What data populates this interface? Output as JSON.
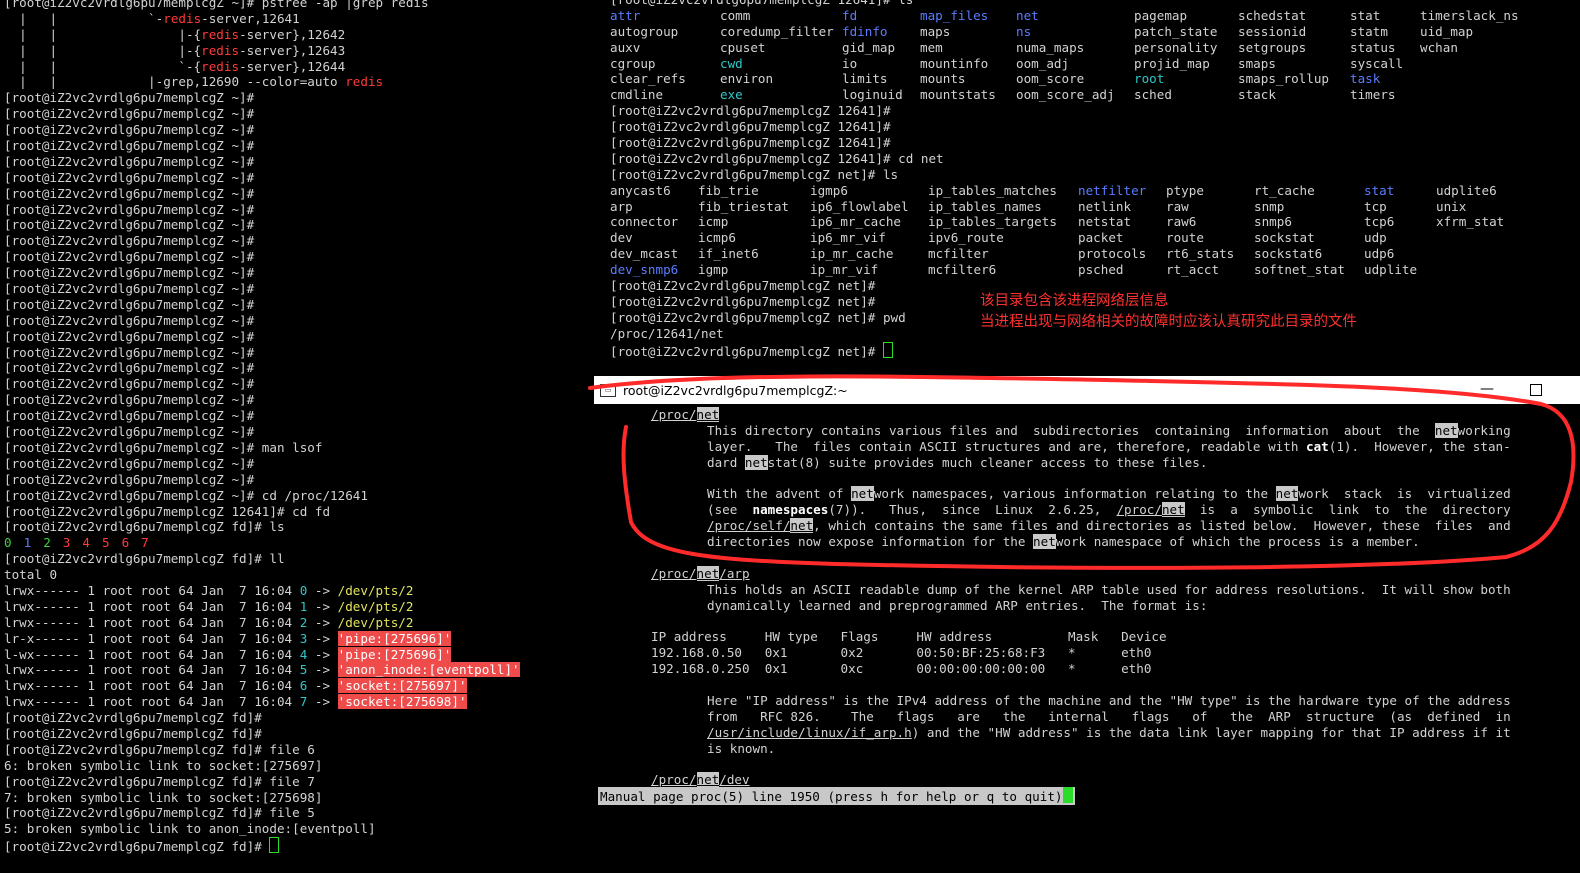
{
  "left_terminal": {
    "pstree_lines": [
      {
        "pre": "[root@iZ2vc2vrdlg6pu7memplcgZ ~]# pstree -ap |grep redis"
      },
      {
        "pre": "  |   |            `-",
        "red": "redis",
        "post": "-server,12641"
      },
      {
        "pre": "  |   |                |-{",
        "red": "redis",
        "post": "-server},12642"
      },
      {
        "pre": "  |   |                |-{",
        "red": "redis",
        "post": "-server},12643"
      },
      {
        "pre": "  |   |                `-{",
        "red": "redis",
        "post": "-server},12644"
      },
      {
        "pre": "  |   |            |-grep,12690 --color=auto ",
        "red": "redis",
        "post": ""
      }
    ],
    "prompt_home": "[root@iZ2vc2vrdlg6pu7memplcgZ ~]#",
    "man_cmd": "[root@iZ2vc2vrdlg6pu7memplcgZ ~]# man lsof",
    "cd_proc": "[root@iZ2vc2vrdlg6pu7memplcgZ ~]# cd /proc/12641",
    "cd_fd": "[root@iZ2vc2vrdlg6pu7memplcgZ 12641]# cd fd",
    "ls_cmd": "[root@iZ2vc2vrdlg6pu7memplcgZ fd]# ls",
    "fd_digits": [
      "0",
      "1",
      "2",
      "3",
      "4",
      "5",
      "6",
      "7"
    ],
    "ll_cmd": "[root@iZ2vc2vrdlg6pu7memplcgZ fd]# ll",
    "total": "total 0",
    "ll_rows": [
      {
        "perm": "lrwx------ 1 root root 64 Jan  7 16:04 ",
        "fd": "0",
        "arrow": " -> ",
        "target": "/dev/pts/2",
        "hl": false
      },
      {
        "perm": "lrwx------ 1 root root 64 Jan  7 16:04 ",
        "fd": "1",
        "arrow": " -> ",
        "target": "/dev/pts/2",
        "hl": false
      },
      {
        "perm": "lrwx------ 1 root root 64 Jan  7 16:04 ",
        "fd": "2",
        "arrow": " -> ",
        "target": "/dev/pts/2",
        "hl": false
      },
      {
        "perm": "lr-x------ 1 root root 64 Jan  7 16:04 ",
        "fd": "3",
        "arrow": " -> ",
        "target": "'pipe:[275696]'",
        "hl": true
      },
      {
        "perm": "l-wx------ 1 root root 64 Jan  7 16:04 ",
        "fd": "4",
        "arrow": " -> ",
        "target": "'pipe:[275696]'",
        "hl": true
      },
      {
        "perm": "lrwx------ 1 root root 64 Jan  7 16:04 ",
        "fd": "5",
        "arrow": " -> ",
        "target": "'anon_inode:[eventpoll]'",
        "hl": true
      },
      {
        "perm": "lrwx------ 1 root root 64 Jan  7 16:04 ",
        "fd": "6",
        "arrow": " -> ",
        "target": "'socket:[275697]'",
        "hl": true
      },
      {
        "perm": "lrwx------ 1 root root 64 Jan  7 16:04 ",
        "fd": "7",
        "arrow": " -> ",
        "target": "'socket:[275698]'",
        "hl": true
      }
    ],
    "prompt_fd": "[root@iZ2vc2vrdlg6pu7memplcgZ fd]#",
    "file6_cmd": "[root@iZ2vc2vrdlg6pu7memplcgZ fd]# file 6",
    "file6_out": "6: broken symbolic link to socket:[275697]",
    "file7_cmd": "[root@iZ2vc2vrdlg6pu7memplcgZ fd]# file 7",
    "file7_out": "7: broken symbolic link to socket:[275698]",
    "file5_cmd": "[root@iZ2vc2vrdlg6pu7memplcgZ fd]# file 5",
    "file5_out": "5: broken symbolic link to anon_inode:[eventpoll]",
    "last_prompt": "[root@iZ2vc2vrdlg6pu7memplcgZ fd]# "
  },
  "right_terminal": {
    "top_partial": "[root@iZ2vc2vrdlg6pu7memplcgZ 12641]# ls",
    "pid_ls_rows": [
      [
        [
          "attr",
          "blue"
        ],
        [
          "comm",
          ""
        ],
        [
          "fd",
          "blue"
        ],
        [
          "map_files",
          "blue"
        ],
        [
          "net",
          "blue"
        ],
        [
          "pagemap",
          ""
        ],
        [
          "schedstat",
          ""
        ],
        [
          "stat",
          ""
        ],
        [
          "timerslack_ns",
          ""
        ]
      ],
      [
        [
          "autogroup",
          ""
        ],
        [
          "coredump_filter",
          ""
        ],
        [
          "fdinfo",
          "blue"
        ],
        [
          "maps",
          ""
        ],
        [
          "ns",
          "blue"
        ],
        [
          "patch_state",
          ""
        ],
        [
          "sessionid",
          ""
        ],
        [
          "statm",
          ""
        ],
        [
          "uid_map",
          ""
        ]
      ],
      [
        [
          "auxv",
          ""
        ],
        [
          "cpuset",
          ""
        ],
        [
          "gid_map",
          ""
        ],
        [
          "mem",
          ""
        ],
        [
          "numa_maps",
          ""
        ],
        [
          "personality",
          ""
        ],
        [
          "setgroups",
          ""
        ],
        [
          "status",
          ""
        ],
        [
          "wchan",
          ""
        ]
      ],
      [
        [
          "cgroup",
          ""
        ],
        [
          "cwd",
          "cyan"
        ],
        [
          "io",
          ""
        ],
        [
          "mountinfo",
          ""
        ],
        [
          "oom_adj",
          ""
        ],
        [
          "projid_map",
          ""
        ],
        [
          "smaps",
          ""
        ],
        [
          "syscall",
          ""
        ],
        [
          "",
          ""
        ]
      ],
      [
        [
          "clear_refs",
          ""
        ],
        [
          "environ",
          ""
        ],
        [
          "limits",
          ""
        ],
        [
          "mounts",
          ""
        ],
        [
          "oom_score",
          ""
        ],
        [
          "root",
          "cyan"
        ],
        [
          "smaps_rollup",
          ""
        ],
        [
          "task",
          "blue"
        ],
        [
          "",
          ""
        ]
      ],
      [
        [
          "cmdline",
          ""
        ],
        [
          "exe",
          "cyan"
        ],
        [
          "loginuid",
          ""
        ],
        [
          "mountstats",
          ""
        ],
        [
          "oom_score_adj",
          ""
        ],
        [
          "sched",
          ""
        ],
        [
          "stack",
          ""
        ],
        [
          "timers",
          ""
        ],
        [
          "",
          ""
        ]
      ]
    ],
    "prompt_pid": "[root@iZ2vc2vrdlg6pu7memplcgZ 12641]#",
    "cd_net": "[root@iZ2vc2vrdlg6pu7memplcgZ 12641]# cd net",
    "ls_net": "[root@iZ2vc2vrdlg6pu7memplcgZ net]# ls",
    "net_ls_rows": [
      [
        [
          "anycast6",
          ""
        ],
        [
          "fib_trie",
          ""
        ],
        [
          "igmp6",
          ""
        ],
        [
          "ip_tables_matches",
          ""
        ],
        [
          "netfilter",
          "blue"
        ],
        [
          "ptype",
          ""
        ],
        [
          "rt_cache",
          ""
        ],
        [
          "stat",
          "blue"
        ],
        [
          "udplite6",
          ""
        ]
      ],
      [
        [
          "arp",
          ""
        ],
        [
          "fib_triestat",
          ""
        ],
        [
          "ip6_flowlabel",
          ""
        ],
        [
          "ip_tables_names",
          ""
        ],
        [
          "netlink",
          ""
        ],
        [
          "raw",
          ""
        ],
        [
          "snmp",
          ""
        ],
        [
          "tcp",
          ""
        ],
        [
          "unix",
          ""
        ]
      ],
      [
        [
          "connector",
          ""
        ],
        [
          "icmp",
          ""
        ],
        [
          "ip6_mr_cache",
          ""
        ],
        [
          "ip_tables_targets",
          ""
        ],
        [
          "netstat",
          ""
        ],
        [
          "raw6",
          ""
        ],
        [
          "snmp6",
          ""
        ],
        [
          "tcp6",
          ""
        ],
        [
          "xfrm_stat",
          ""
        ]
      ],
      [
        [
          "dev",
          ""
        ],
        [
          "icmp6",
          ""
        ],
        [
          "ip6_mr_vif",
          ""
        ],
        [
          "ipv6_route",
          ""
        ],
        [
          "packet",
          ""
        ],
        [
          "route",
          ""
        ],
        [
          "sockstat",
          ""
        ],
        [
          "udp",
          ""
        ],
        [
          "",
          ""
        ]
      ],
      [
        [
          "dev_mcast",
          ""
        ],
        [
          "if_inet6",
          ""
        ],
        [
          "ip_mr_cache",
          ""
        ],
        [
          "mcfilter",
          ""
        ],
        [
          "protocols",
          ""
        ],
        [
          "rt6_stats",
          ""
        ],
        [
          "sockstat6",
          ""
        ],
        [
          "udp6",
          ""
        ],
        [
          "",
          ""
        ]
      ],
      [
        [
          "dev_snmp6",
          "blue"
        ],
        [
          "igmp",
          ""
        ],
        [
          "ip_mr_vif",
          ""
        ],
        [
          "mcfilter6",
          ""
        ],
        [
          "psched",
          ""
        ],
        [
          "rt_acct",
          ""
        ],
        [
          "softnet_stat",
          ""
        ],
        [
          "udplite",
          ""
        ],
        [
          "",
          ""
        ]
      ]
    ],
    "prompt_net": "[root@iZ2vc2vrdlg6pu7memplcgZ net]#",
    "pwd_cmd": "[root@iZ2vc2vrdlg6pu7memplcgZ net]# pwd",
    "pwd_out": "/proc/12641/net",
    "final_prompt": "[root@iZ2vc2vrdlg6pu7memplcgZ net]# ",
    "annotation_line1": "该目录包含该进程网络层信息",
    "annotation_line2": "当进程出现与网络相关的故障时应该认真研究此目录的文件"
  },
  "man_window": {
    "title": "root@iZ2vc2vrdlg6pu7memplcgZ:~",
    "minimize": "—",
    "icon_text": "▭",
    "h1_pre": "/proc/",
    "net": "net",
    "p1_l1a": "This directory contains various files and  subdirectories  containing  information  about  the  ",
    "p1_l1b": "working",
    "p1_l2a": "layer.   The  files contain ASCII structures and are, therefore, readable with ",
    "cat": "cat",
    "p1_l2b": "(1).  However, the stan‐",
    "p1_l3a": "dard ",
    "p1_l3b": "stat(8) suite provides much cleaner access to these files.",
    "p2_l1a": "With the advent of ",
    "p2_l1b": "work namespaces, various information relating to the ",
    "p2_l1c": "work  stack  is  virtualized",
    "p2_l2a": "(see  ",
    "namespaces": "namespaces",
    "p2_l2b": "(7)).   Thus,  since  Linux  2.6.25,  ",
    "proc_slash": "/proc/",
    "p2_l2c": "  is  a  symbolic  link  to  the  directory",
    "proc_self": "/proc/self/",
    "p2_l3b": ", which contains the same files and directories as listed below.  However, these  files  and",
    "p2_l4a": "directories now expose information for the ",
    "p2_l4b": "work namespace of which the process is a member.",
    "h2_suffix": "/arp",
    "arp_l1": "This holds an ASCII readable dump of the kernel ARP table used for address resolutions.  It will show both",
    "arp_l2": "dynamically learned and preprogrammed ARP entries.  The format is:",
    "arp_header": "IP address     HW type   Flags     HW address          Mask   Device",
    "arp_row1": "192.168.0.50   0x1       0x2       00:50:BF:25:68:F3   *      eth0",
    "arp_row2": "192.168.0.250  0x1       0xc       00:00:00:00:00:00   *      eth0",
    "arp_p2_l1": "Here \"IP address\" is the IPv4 address of the machine and the \"HW type\" is the hardware type of the address",
    "arp_p2_l2": "from   RFC 826.    The   flags   are   the   internal   flags   of   the  ARP  structure  (as  defined  in",
    "arp_p2_l3a": "/usr/include/linux/if_arp.h",
    "arp_p2_l3b": ") and the \"HW address\" is the data link layer mapping for that IP address if it",
    "arp_p2_l4": "is known.",
    "h3_suffix": "/dev",
    "status": "Manual page proc(5) line 1950 (press h for help or q to quit)"
  },
  "colors": {
    "term_bg": "#000000",
    "term_fg": "#d2d2d2",
    "dir_blue": "#5a7cff",
    "link_cyan": "#2ec7c7",
    "grep_red": "#ff3a3a",
    "pipe_bg": "#ef4b4b",
    "annotation_red": "#ff3030"
  }
}
